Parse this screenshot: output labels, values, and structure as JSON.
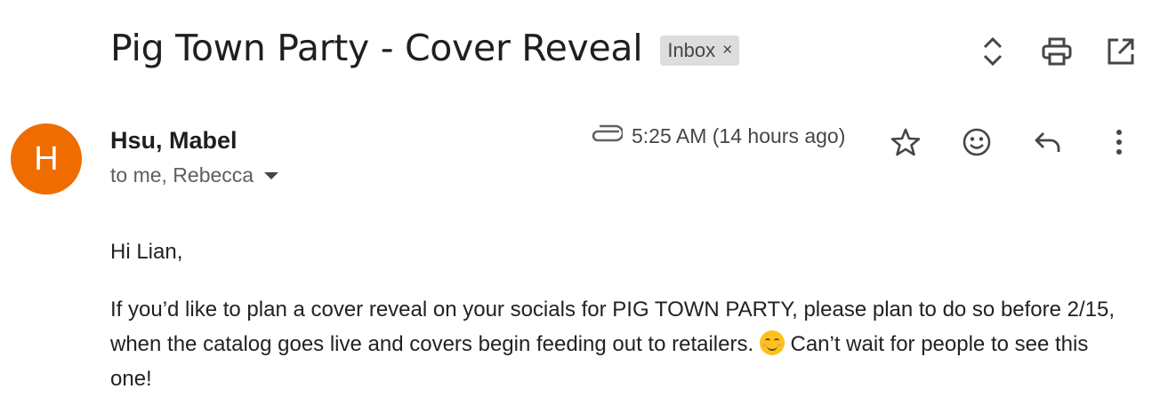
{
  "email": {
    "subject": "Pig Town Party - Cover Reveal",
    "label": {
      "text": "Inbox",
      "remove_glyph": "×"
    },
    "sender": {
      "avatar_initial": "H",
      "avatar_color": "#ef6c00",
      "name": "Hsu, Mabel",
      "recipients": "to me, Rebecca"
    },
    "timestamp": "5:25 AM (14 hours ago)",
    "has_attachment": true,
    "body": {
      "greeting": "Hi Lian,",
      "paragraph_before_emoji": "If you’d like to plan a cover reveal on your socials for PIG TOWN PARTY, please plan to do so before 2/15, when the catalog goes live and covers begin feeding out to retailers.",
      "paragraph_after_emoji": "Can’t wait for people to see this one!"
    }
  },
  "icons": {
    "expand": "expand-collapse-icon",
    "print": "print-icon",
    "popout": "open-in-new-window-icon",
    "attachment": "paperclip-icon",
    "star": "star-icon",
    "emoji_react": "emoji-react-icon",
    "reply": "reply-icon",
    "more": "more-vertical-icon"
  }
}
